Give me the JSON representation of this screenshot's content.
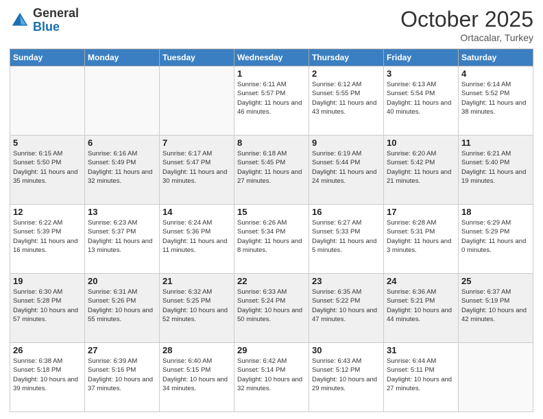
{
  "logo": {
    "general": "General",
    "blue": "Blue"
  },
  "header": {
    "month": "October 2025",
    "location": "Ortacalar, Turkey"
  },
  "days_of_week": [
    "Sunday",
    "Monday",
    "Tuesday",
    "Wednesday",
    "Thursday",
    "Friday",
    "Saturday"
  ],
  "weeks": [
    [
      {
        "day": "",
        "info": ""
      },
      {
        "day": "",
        "info": ""
      },
      {
        "day": "",
        "info": ""
      },
      {
        "day": "1",
        "info": "Sunrise: 6:11 AM\nSunset: 5:57 PM\nDaylight: 11 hours and 46 minutes."
      },
      {
        "day": "2",
        "info": "Sunrise: 6:12 AM\nSunset: 5:55 PM\nDaylight: 11 hours and 43 minutes."
      },
      {
        "day": "3",
        "info": "Sunrise: 6:13 AM\nSunset: 5:54 PM\nDaylight: 11 hours and 40 minutes."
      },
      {
        "day": "4",
        "info": "Sunrise: 6:14 AM\nSunset: 5:52 PM\nDaylight: 11 hours and 38 minutes."
      }
    ],
    [
      {
        "day": "5",
        "info": "Sunrise: 6:15 AM\nSunset: 5:50 PM\nDaylight: 11 hours and 35 minutes."
      },
      {
        "day": "6",
        "info": "Sunrise: 6:16 AM\nSunset: 5:49 PM\nDaylight: 11 hours and 32 minutes."
      },
      {
        "day": "7",
        "info": "Sunrise: 6:17 AM\nSunset: 5:47 PM\nDaylight: 11 hours and 30 minutes."
      },
      {
        "day": "8",
        "info": "Sunrise: 6:18 AM\nSunset: 5:45 PM\nDaylight: 11 hours and 27 minutes."
      },
      {
        "day": "9",
        "info": "Sunrise: 6:19 AM\nSunset: 5:44 PM\nDaylight: 11 hours and 24 minutes."
      },
      {
        "day": "10",
        "info": "Sunrise: 6:20 AM\nSunset: 5:42 PM\nDaylight: 11 hours and 21 minutes."
      },
      {
        "day": "11",
        "info": "Sunrise: 6:21 AM\nSunset: 5:40 PM\nDaylight: 11 hours and 19 minutes."
      }
    ],
    [
      {
        "day": "12",
        "info": "Sunrise: 6:22 AM\nSunset: 5:39 PM\nDaylight: 11 hours and 16 minutes."
      },
      {
        "day": "13",
        "info": "Sunrise: 6:23 AM\nSunset: 5:37 PM\nDaylight: 11 hours and 13 minutes."
      },
      {
        "day": "14",
        "info": "Sunrise: 6:24 AM\nSunset: 5:36 PM\nDaylight: 11 hours and 11 minutes."
      },
      {
        "day": "15",
        "info": "Sunrise: 6:26 AM\nSunset: 5:34 PM\nDaylight: 11 hours and 8 minutes."
      },
      {
        "day": "16",
        "info": "Sunrise: 6:27 AM\nSunset: 5:33 PM\nDaylight: 11 hours and 5 minutes."
      },
      {
        "day": "17",
        "info": "Sunrise: 6:28 AM\nSunset: 5:31 PM\nDaylight: 11 hours and 3 minutes."
      },
      {
        "day": "18",
        "info": "Sunrise: 6:29 AM\nSunset: 5:29 PM\nDaylight: 11 hours and 0 minutes."
      }
    ],
    [
      {
        "day": "19",
        "info": "Sunrise: 6:30 AM\nSunset: 5:28 PM\nDaylight: 10 hours and 57 minutes."
      },
      {
        "day": "20",
        "info": "Sunrise: 6:31 AM\nSunset: 5:26 PM\nDaylight: 10 hours and 55 minutes."
      },
      {
        "day": "21",
        "info": "Sunrise: 6:32 AM\nSunset: 5:25 PM\nDaylight: 10 hours and 52 minutes."
      },
      {
        "day": "22",
        "info": "Sunrise: 6:33 AM\nSunset: 5:24 PM\nDaylight: 10 hours and 50 minutes."
      },
      {
        "day": "23",
        "info": "Sunrise: 6:35 AM\nSunset: 5:22 PM\nDaylight: 10 hours and 47 minutes."
      },
      {
        "day": "24",
        "info": "Sunrise: 6:36 AM\nSunset: 5:21 PM\nDaylight: 10 hours and 44 minutes."
      },
      {
        "day": "25",
        "info": "Sunrise: 6:37 AM\nSunset: 5:19 PM\nDaylight: 10 hours and 42 minutes."
      }
    ],
    [
      {
        "day": "26",
        "info": "Sunrise: 6:38 AM\nSunset: 5:18 PM\nDaylight: 10 hours and 39 minutes."
      },
      {
        "day": "27",
        "info": "Sunrise: 6:39 AM\nSunset: 5:16 PM\nDaylight: 10 hours and 37 minutes."
      },
      {
        "day": "28",
        "info": "Sunrise: 6:40 AM\nSunset: 5:15 PM\nDaylight: 10 hours and 34 minutes."
      },
      {
        "day": "29",
        "info": "Sunrise: 6:42 AM\nSunset: 5:14 PM\nDaylight: 10 hours and 32 minutes."
      },
      {
        "day": "30",
        "info": "Sunrise: 6:43 AM\nSunset: 5:12 PM\nDaylight: 10 hours and 29 minutes."
      },
      {
        "day": "31",
        "info": "Sunrise: 6:44 AM\nSunset: 5:11 PM\nDaylight: 10 hours and 27 minutes."
      },
      {
        "day": "",
        "info": ""
      }
    ]
  ]
}
